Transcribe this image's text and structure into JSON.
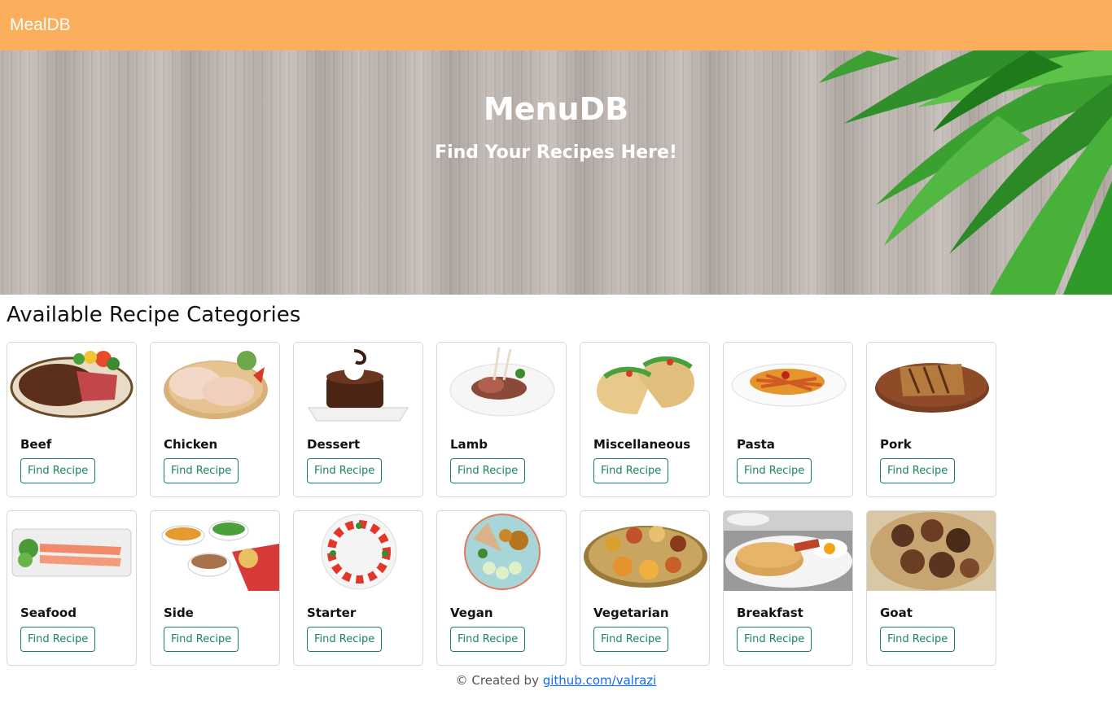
{
  "navbar": {
    "brand": "MealDB"
  },
  "hero": {
    "title": "MenuDB",
    "subtitle": "Find Your Recipes Here!"
  },
  "section": {
    "title": "Available Recipe Categories"
  },
  "button_label": "Find Recipe",
  "categories": [
    {
      "name": "Beef",
      "icon": "beef-steak-image"
    },
    {
      "name": "Chicken",
      "icon": "chicken-legs-image"
    },
    {
      "name": "Dessert",
      "icon": "chocolate-cake-image"
    },
    {
      "name": "Lamb",
      "icon": "lamb-chops-image"
    },
    {
      "name": "Miscellaneous",
      "icon": "tacos-image"
    },
    {
      "name": "Pasta",
      "icon": "pasta-plate-image"
    },
    {
      "name": "Pork",
      "icon": "pork-steak-image"
    },
    {
      "name": "Seafood",
      "icon": "salmon-platter-image"
    },
    {
      "name": "Side",
      "icon": "side-dishes-image"
    },
    {
      "name": "Starter",
      "icon": "caprese-salad-image"
    },
    {
      "name": "Vegan",
      "icon": "vegan-bowl-image"
    },
    {
      "name": "Vegetarian",
      "icon": "thali-platter-image"
    },
    {
      "name": "Breakfast",
      "icon": "pancakes-eggs-image"
    },
    {
      "name": "Goat",
      "icon": "goat-curry-image"
    }
  ],
  "footer": {
    "prefix": "© Created by ",
    "link_text": "github.com/valrazi"
  },
  "colors": {
    "navbar": "#fbae5c",
    "button": "#198754",
    "link": "#0d6efd"
  }
}
